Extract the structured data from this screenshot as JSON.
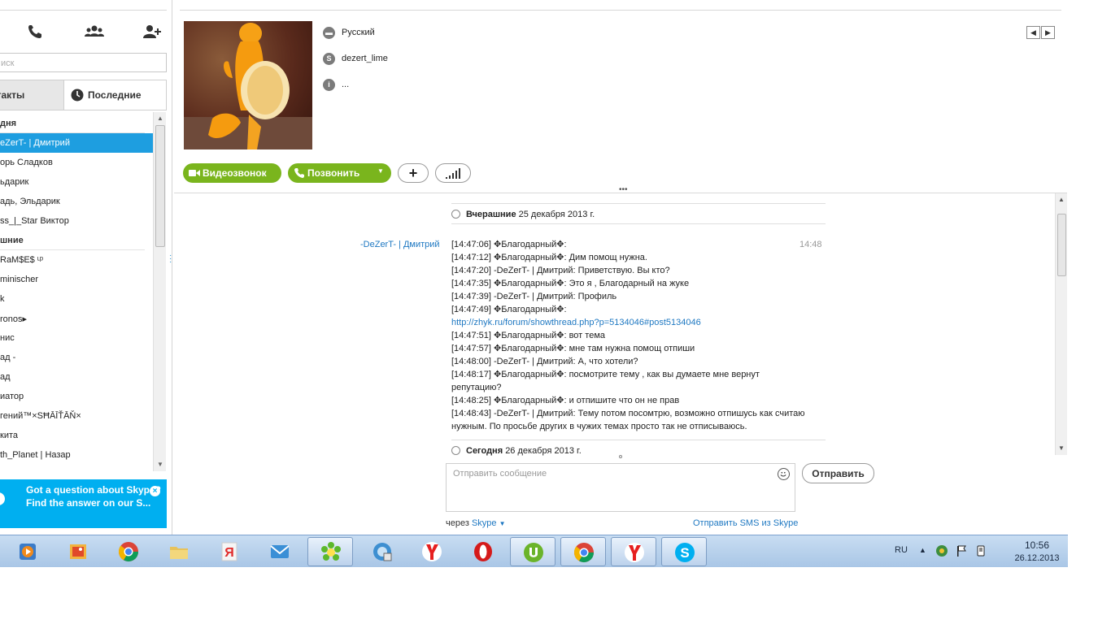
{
  "sidebar": {
    "search_placeholder": "иск",
    "tabs": {
      "contacts": "онтакты",
      "recent": "Последние"
    },
    "groups": [
      {
        "label": "дня",
        "items": [
          {
            "label": "eZerT- | Дмитрий",
            "selected": true
          },
          {
            "label": "орь Сладков"
          },
          {
            "label": "ьдарик"
          },
          {
            "label": "адь, Эльдарик"
          },
          {
            "label": "ss_|_Star Виктор"
          }
        ]
      },
      {
        "label": "шние",
        "items": [
          {
            "label": "RaM$E$ ᶫᵖ"
          },
          {
            "label": "minischer"
          },
          {
            "label": "k"
          },
          {
            "label": "ronos▸"
          },
          {
            "label": "нис"
          },
          {
            "label": "ад -"
          },
          {
            "label": "ад"
          },
          {
            "label": "иатор"
          },
          {
            "label": "гений™×SĦĀĪŤĀŇ×"
          },
          {
            "label": "кита"
          },
          {
            "label": "th_Planet | Назар"
          }
        ]
      }
    ],
    "promo": {
      "title": "Got a question about Skype?",
      "body": "Find the answer on our S...",
      "close": "×"
    }
  },
  "profile": {
    "language": "Русский",
    "skype_name": "dezert_lime",
    "info": "...",
    "buttons": {
      "video_call": "Видеозвонок",
      "call": "Позвонить",
      "add": "+",
      "call_quality": "signal"
    }
  },
  "chat": {
    "yesterday_label": "Вчерашние",
    "yesterday_date": "25 декабря 2013 г.",
    "today_label": "Сегодня",
    "today_date": "26 декабря 2013 г.",
    "sender": "-DeZerT- | Дмитрий",
    "time": "14:48",
    "messages": [
      "[14:47:06] ✥Благодарный✥:",
      "[14:47:12] ✥Благодарный✥: Дим помощ нужна.",
      "[14:47:20] -DeZerT- | Дмитрий: Приветствую. Вы кто?",
      "[14:47:35] ✥Благодарный✥: Это я , Благодарный на жуке",
      "[14:47:39] -DeZerT- | Дмитрий: Профиль",
      "[14:47:49] ✥Благодарный✥:",
      "http://zhyk.ru/forum/showthread.php?p=5134046#post5134046",
      "[14:47:51] ✥Благодарный✥: вот тема",
      "[14:47:57] ✥Благодарный✥: мне там нужна помощ отпиши",
      "[14:48:00] -DeZerT- | Дмитрий: А, что хотели?",
      "[14:48:17] ✥Благодарный✥: посмотрите тему , как вы думаете мне вернут репутацию?",
      "[14:48:25] ✥Благодарный✥: и отпишите что он не прав",
      "[14:48:43] -DeZerT- | Дмитрий: Тему потом посомтрю, возможно отпишусь как считаю нужным. По просьбе других в чужих темах просто так не отписываюсь."
    ]
  },
  "composer": {
    "placeholder": "Отправить сообщение",
    "send": "Отправить",
    "via_prefix": "через",
    "via_link": "Skype",
    "sms_link": "Отправить SMS из Skype"
  },
  "taskbar": {
    "lang": "RU",
    "time": "10:56",
    "date": "26.12.2013",
    "apps": [
      "media-player",
      "gallery",
      "chrome",
      "explorer",
      "yandex-browser",
      "mail",
      "icq",
      "network",
      "yandex",
      "opera",
      "utorrent",
      "chrome",
      "yandex",
      "skype"
    ]
  }
}
